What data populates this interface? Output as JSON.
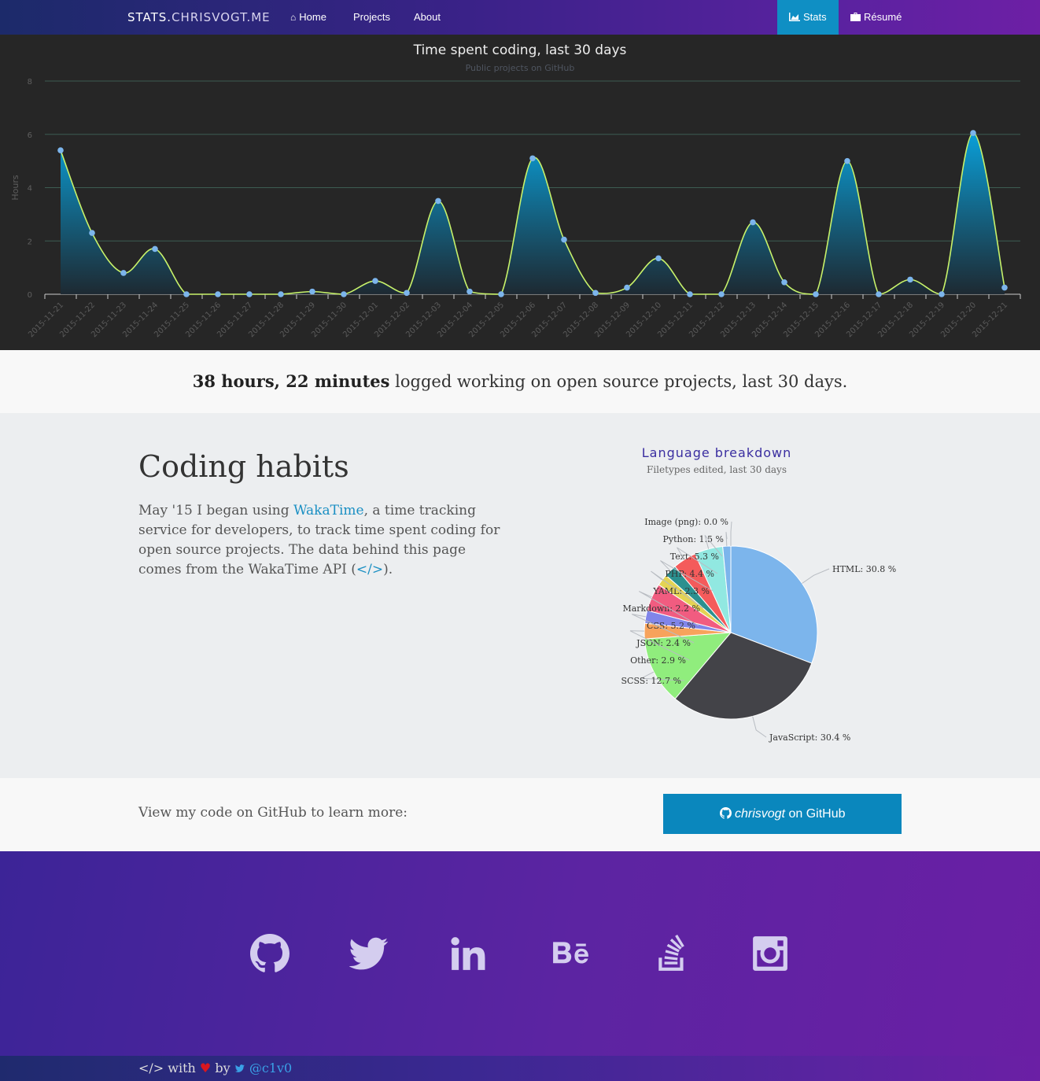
{
  "nav": {
    "brand_bold": "STATS.",
    "brand_light": "CHRISVOGT.ME",
    "home": "Home",
    "projects": "Projects",
    "about": "About",
    "stats": "Stats",
    "resume": "Résumé"
  },
  "summary": {
    "bold": "38 hours, 22 minutes",
    "rest": " logged working on open source projects, last 30 days."
  },
  "habits": {
    "heading": "Coding habits",
    "p1": "May '15 I began using ",
    "link": "WakaTime",
    "p2": ", a time tracking service for developers, to track time spent coding for open source projects. The data behind this page comes from the WakaTime API (",
    "api_icon": "</>",
    "p3": ")."
  },
  "github": {
    "lead": "View my code on GitHub to learn more:",
    "button_user": "chrisvogt",
    "button_rest": " on GitHub"
  },
  "footer": {
    "credit_code": "</>",
    "credit_with": " with ",
    "credit_by": " by ",
    "handle": "@c1v0"
  },
  "social": [
    "github-icon",
    "twitter-icon",
    "linkedin-icon",
    "behance-icon",
    "stackoverflow-icon",
    "instagram-icon"
  ],
  "chart_data": [
    {
      "type": "area",
      "title": "Time spent coding, last 30 days",
      "subtitle": "Public projects on GitHub",
      "ylabel": "Hours",
      "ylim": [
        0,
        8
      ],
      "yticks": [
        0,
        2,
        4,
        6,
        8
      ],
      "x": [
        "2015-11-21",
        "2015-11-22",
        "2015-11-23",
        "2015-11-24",
        "2015-11-25",
        "2015-11-26",
        "2015-11-27",
        "2015-11-28",
        "2015-11-29",
        "2015-11-30",
        "2015-12-01",
        "2015-12-02",
        "2015-12-03",
        "2015-12-04",
        "2015-12-05",
        "2015-12-06",
        "2015-12-07",
        "2015-12-08",
        "2015-12-09",
        "2015-12-10",
        "2015-12-11",
        "2015-12-12",
        "2015-12-13",
        "2015-12-14",
        "2015-12-15",
        "2015-12-16",
        "2015-12-17",
        "2015-12-18",
        "2015-12-19",
        "2015-12-20",
        "2015-12-21"
      ],
      "values": [
        5.4,
        2.3,
        0.8,
        1.7,
        0.0,
        0.0,
        0.0,
        0.0,
        0.1,
        0.0,
        0.5,
        0.05,
        3.5,
        0.1,
        0.0,
        5.1,
        2.05,
        0.05,
        0.25,
        1.35,
        0.0,
        0.0,
        2.7,
        0.45,
        0.0,
        5.0,
        0.0,
        0.55,
        0.0,
        6.05,
        0.25
      ],
      "colors": {
        "line": "#c8f26a",
        "fill_top": "#0a9fd8",
        "point": "#7cb5ec",
        "grid": "#3c5c52"
      },
      "grid": true
    },
    {
      "type": "pie",
      "title": "Language breakdown",
      "subtitle": "Filetypes edited, last 30 days",
      "slices": [
        {
          "name": "HTML",
          "value": 30.8,
          "label": "HTML: 30.8 %",
          "color": "#7cb5ec"
        },
        {
          "name": "JavaScript",
          "value": 30.4,
          "label": "JavaScript: 30.4 %",
          "color": "#434348"
        },
        {
          "name": "SCSS",
          "value": 12.7,
          "label": "SCSS: 12.7 %",
          "color": "#90ed7d"
        },
        {
          "name": "Other",
          "value": 2.9,
          "label": "Other: 2.9 %",
          "color": "#f7a35c"
        },
        {
          "name": "JSON",
          "value": 2.4,
          "label": "JSON: 2.4 %",
          "color": "#8085e9"
        },
        {
          "name": "CSS",
          "value": 5.2,
          "label": "CSS: 5.2 %",
          "color": "#f15c80"
        },
        {
          "name": "Markdown",
          "value": 2.2,
          "label": "Markdown: 2.2 %",
          "color": "#e4d354"
        },
        {
          "name": "YAML",
          "value": 2.3,
          "label": "YAML: 2.3 %",
          "color": "#2b908f"
        },
        {
          "name": "PHP",
          "value": 4.4,
          "label": "PHP: 4.4 %",
          "color": "#f45b5b"
        },
        {
          "name": "Text",
          "value": 5.3,
          "label": "Text: 5.3 %",
          "color": "#91e8e1"
        },
        {
          "name": "Python",
          "value": 1.5,
          "label": "Python: 1.5 %",
          "color": "#7cb5ec"
        },
        {
          "name": "Image (png)",
          "value": 0.0,
          "label": "Image (png): 0.0 %",
          "color": "#434348"
        }
      ]
    }
  ]
}
